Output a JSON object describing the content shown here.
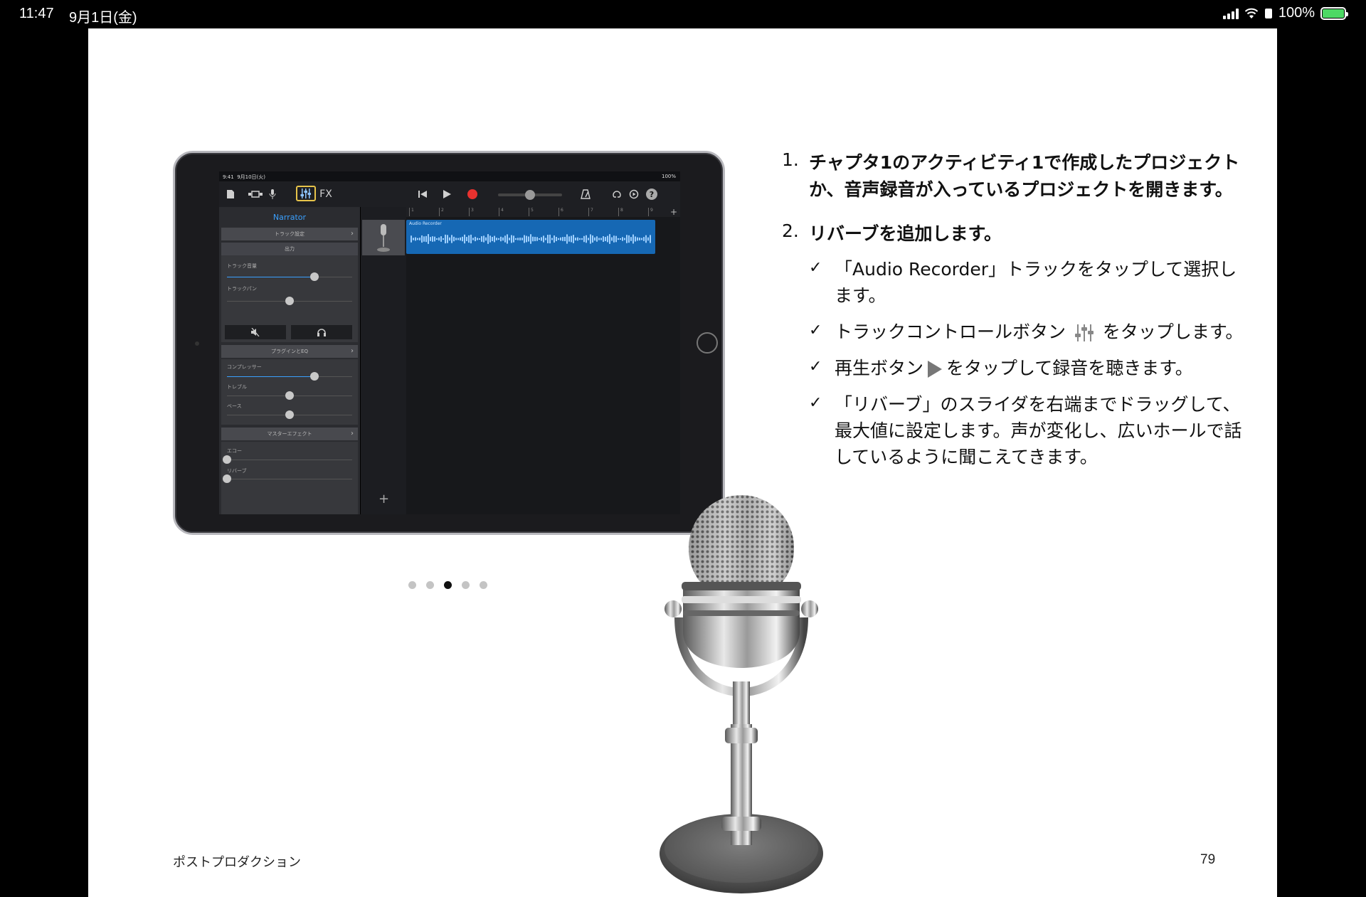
{
  "status_bar": {
    "time": "11:47",
    "date": "9月1日(金)",
    "battery": "100%",
    "battery_color": "#4cd964"
  },
  "ipad_screen": {
    "status_time": "9:41",
    "status_date": "9月10日(火)",
    "status_right": "100%",
    "toolbar": {
      "fx_label": "FX",
      "help_label": "?"
    },
    "side_panel": {
      "title": "Narrator",
      "track_settings": "トラック設定",
      "output": "出力",
      "track_volume": "トラック音量",
      "track_pan": "トラックパン",
      "plugins_eq": "プラグインとEQ",
      "compressor": "コンプレッサー",
      "treble": "トレブル",
      "bass": "ベース",
      "master_effect": "マスターエフェクト",
      "echo": "エコー",
      "reverb": "リバーブ",
      "sliders": {
        "track_volume": 0.7,
        "track_pan": 0.5,
        "compressor": 0.7,
        "treble": 0.5,
        "bass": 0.5,
        "echo": 0.0,
        "reverb": 0.0
      }
    },
    "region_label": "Audio Recorder",
    "ruler_marks": [
      "1",
      "2",
      "3",
      "4",
      "5",
      "6",
      "7",
      "8",
      "9"
    ],
    "ruler_plus": "+",
    "add_track": "+",
    "accent_color": "#3aa0ff",
    "region_color": "#1668b4",
    "record_color": "#e8322f",
    "highlight_color": "#e6c34a"
  },
  "pagination": {
    "total": 5,
    "active_index": 2
  },
  "steps": [
    {
      "number": "1.",
      "text": "チャプタ1のアクティビティ1で作成したプロジェクトか、音声録音が入っているプロジェクトを開きます。"
    },
    {
      "number": "2.",
      "text": "リバーブを追加します。"
    }
  ],
  "substeps": [
    {
      "text": "「Audio Recorder」トラックをタップして選択します。"
    },
    {
      "text_before": "トラックコントロールボタン",
      "icon": "track-controls-icon",
      "text_after": "をタップします。"
    },
    {
      "text_before": "再生ボタン",
      "icon": "play-icon",
      "text_after": "をタップして録音を聴きます。"
    },
    {
      "text": "「リバーブ」のスライダを右端までドラッグして、最大値に設定します。声が変化し、広いホールで話しているように聞こえてきます。"
    }
  ],
  "footer": {
    "section": "ポストプロダクション",
    "page_number": "79"
  }
}
